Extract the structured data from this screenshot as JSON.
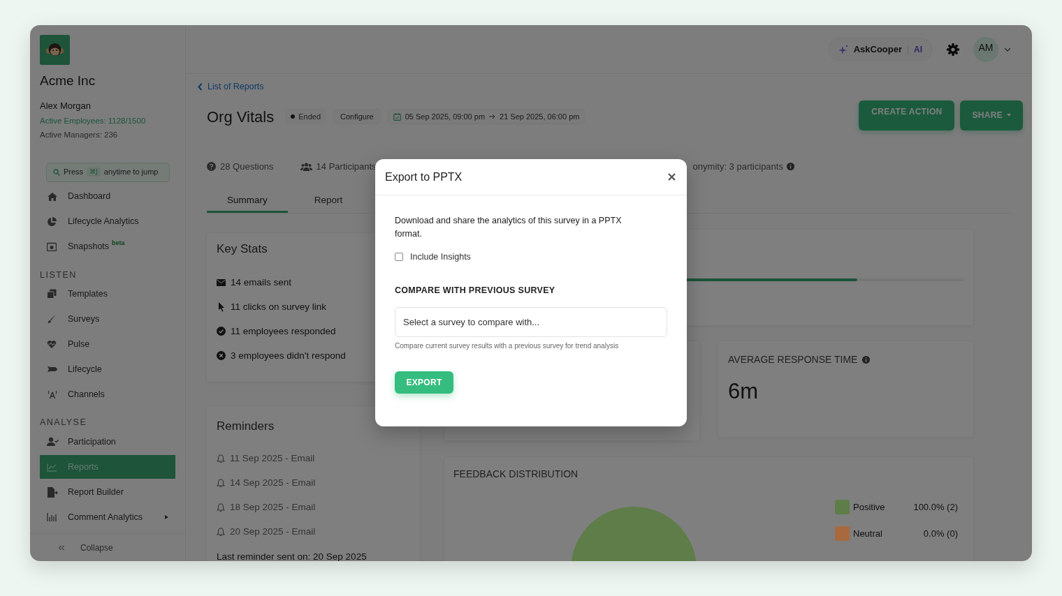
{
  "sidebar": {
    "company": "Acme Inc",
    "user": "Alex Morgan",
    "active_employees": "Active Employees: 1128/1500",
    "active_managers": "Active Managers: 236",
    "jump": {
      "press": "Press",
      "key": "⌘J",
      "hint": "anytime to jump"
    },
    "sections": [
      {
        "items": [
          {
            "label": "Dashboard",
            "kind": "home",
            "selected": false
          },
          {
            "label": "Lifecycle Analytics",
            "kind": "pie",
            "selected": false
          },
          {
            "label": "Snapshots",
            "kind": "camera",
            "selected": false,
            "badge": "beta"
          }
        ]
      },
      {
        "heading": "LISTEN",
        "items": [
          {
            "label": "Templates",
            "kind": "copy",
            "selected": false
          },
          {
            "label": "Surveys",
            "kind": "brush",
            "selected": false
          },
          {
            "label": "Pulse",
            "kind": "heart",
            "selected": false
          },
          {
            "label": "Lifecycle",
            "kind": "rocket",
            "selected": false
          },
          {
            "label": "Channels",
            "kind": "antenna",
            "selected": false
          }
        ]
      },
      {
        "heading": "ANALYSE",
        "items": [
          {
            "label": "Participation",
            "kind": "user",
            "selected": false
          },
          {
            "label": "Reports",
            "kind": "chart",
            "selected": true
          },
          {
            "label": "Report Builder",
            "kind": "file",
            "selected": false
          },
          {
            "label": "Comment Analytics",
            "kind": "bars",
            "selected": false,
            "has_submenu": true
          }
        ]
      }
    ],
    "collapse": "Collapse"
  },
  "header": {
    "assistant": {
      "name": "AskCooper",
      "tag": "AI"
    },
    "avatar": "AM"
  },
  "page": {
    "back_link": "List of Reports",
    "title": "Org Vitals",
    "status": "Ended",
    "configure": "Configure",
    "start": "05 Sep 2025, 09:00 pm",
    "end": "21 Sep 2025, 06:00 pm",
    "actions": [
      {
        "label": "CREATE ACTION",
        "dropdown": false
      },
      {
        "label": "SHARE",
        "dropdown": true
      }
    ],
    "stats": [
      {
        "kind": "questions",
        "text": "28 Questions"
      },
      {
        "kind": "participants",
        "text": "14 Participants"
      }
    ],
    "anonymity_note": "onymity: 3 participants",
    "tabs": [
      {
        "label": "Summary",
        "selected": true
      },
      {
        "label": "Report",
        "selected": false
      }
    ]
  },
  "key_stats": {
    "title": "Key Stats",
    "items": [
      {
        "kind": "email",
        "text": "14 emails sent"
      },
      {
        "kind": "click",
        "text": "11 clicks on survey link"
      },
      {
        "kind": "responded",
        "text": "11 employees responded"
      },
      {
        "kind": "not_responded",
        "text": "3 employees didn't respond"
      }
    ]
  },
  "reminders": {
    "title": "Reminders",
    "items": [
      "11 Sep 2025 - Email",
      "14 Sep 2025 - Email",
      "18 Sep 2025 - Email",
      "20 Sep 2025 - Email"
    ],
    "last": "Last reminder sent on: 20 Sep 2025"
  },
  "response_card": {
    "level": 0.79
  },
  "avg_response": {
    "title": "AVERAGE RESPONSE TIME",
    "value": "6m"
  },
  "feedback": {
    "title": "FEEDBACK DISTRIBUTION",
    "chart_data": {
      "type": "pie",
      "categories": [
        "Positive",
        "Neutral"
      ],
      "values": [
        100,
        0
      ]
    },
    "legend": [
      {
        "value": "100.0% (2)",
        "color": "#5e7d48"
      },
      {
        "value": "0.0% (0)",
        "color": "#a8693f"
      }
    ]
  },
  "modal": {
    "title": "Export to PPTX",
    "description": "Download and share the analytics of this survey in a PPTX format.",
    "include_insights": {
      "label": "Include Insights",
      "checked": false
    },
    "compare_heading": "COMPARE WITH PREVIOUS SURVEY",
    "select_placeholder": "Select a survey to compare with...",
    "help": "Compare current survey results with a previous survey for trend analysis",
    "export": "EXPORT"
  }
}
